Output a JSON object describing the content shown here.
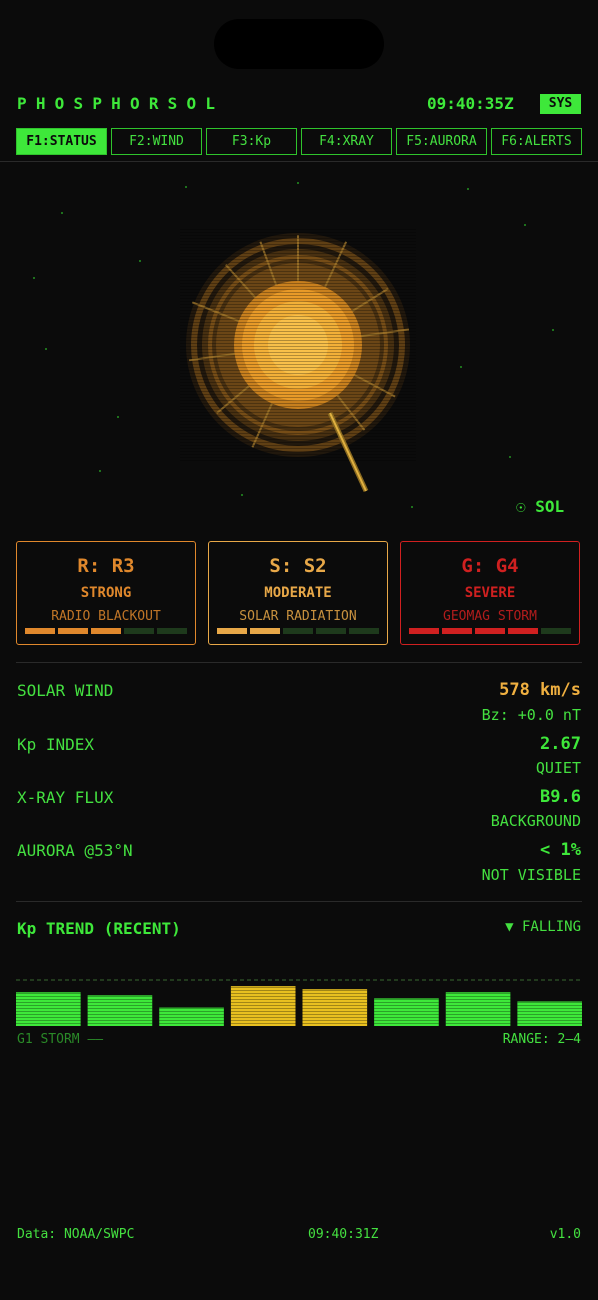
{
  "header": {
    "app_title": "PHOSPHORSOL",
    "clock": "09:40:35Z",
    "sys_label": "SYS"
  },
  "tabs": [
    {
      "label": "F1:STATUS",
      "active": true
    },
    {
      "label": "F2:WIND",
      "active": false
    },
    {
      "label": "F3:Kp",
      "active": false
    },
    {
      "label": "F4:XRAY",
      "active": false
    },
    {
      "label": "F5:AURORA",
      "active": false
    },
    {
      "label": "F6:ALERTS",
      "active": false
    }
  ],
  "sun": {
    "label": "☉ SOL"
  },
  "scales": [
    {
      "code": "R: R3",
      "level": "STRONG",
      "desc": "RADIO BLACKOUT",
      "color": "#e0882c",
      "filled": 3,
      "total": 5
    },
    {
      "code": "S: S2",
      "level": "MODERATE",
      "desc": "SOLAR RADIATION",
      "color": "#e8a848",
      "filled": 2,
      "total": 5
    },
    {
      "code": "G: G4",
      "level": "SEVERE",
      "desc": "GEOMAG STORM",
      "color": "#d02020",
      "filled": 4,
      "total": 5
    }
  ],
  "metrics": [
    {
      "label": "SOLAR WIND",
      "value": "578 km/s",
      "sub": "Bz: +0.0 nT",
      "value_color": "#f0b040"
    },
    {
      "label": "Kp INDEX",
      "value": "2.67",
      "sub": "QUIET",
      "value_color": "#3ee83a"
    },
    {
      "label": "X-RAY FLUX",
      "value": "B9.6",
      "sub": "BACKGROUND",
      "value_color": "#3ee83a"
    },
    {
      "label": "AURORA @53°N",
      "value": "< 1%",
      "sub": "NOT VISIBLE",
      "value_color": "#3ee83a"
    }
  ],
  "trend": {
    "title": "Kp TREND (RECENT)",
    "direction": "▼ FALLING",
    "threshold_label": "G1 STORM ——",
    "range_label": "RANGE: 2—4"
  },
  "chart_data": {
    "type": "bar",
    "values": [
      3.3,
      3.0,
      1.8,
      3.9,
      3.6,
      2.7,
      3.3,
      2.4
    ],
    "threshold": 4.5,
    "ylim": [
      0,
      4.5
    ],
    "colors": {
      "normal": "#3ee83a",
      "elevated": "#e8c020"
    }
  },
  "footer": {
    "source": "Data: NOAA/SWPC",
    "updated": "09:40:31Z",
    "version": "v1.0"
  }
}
